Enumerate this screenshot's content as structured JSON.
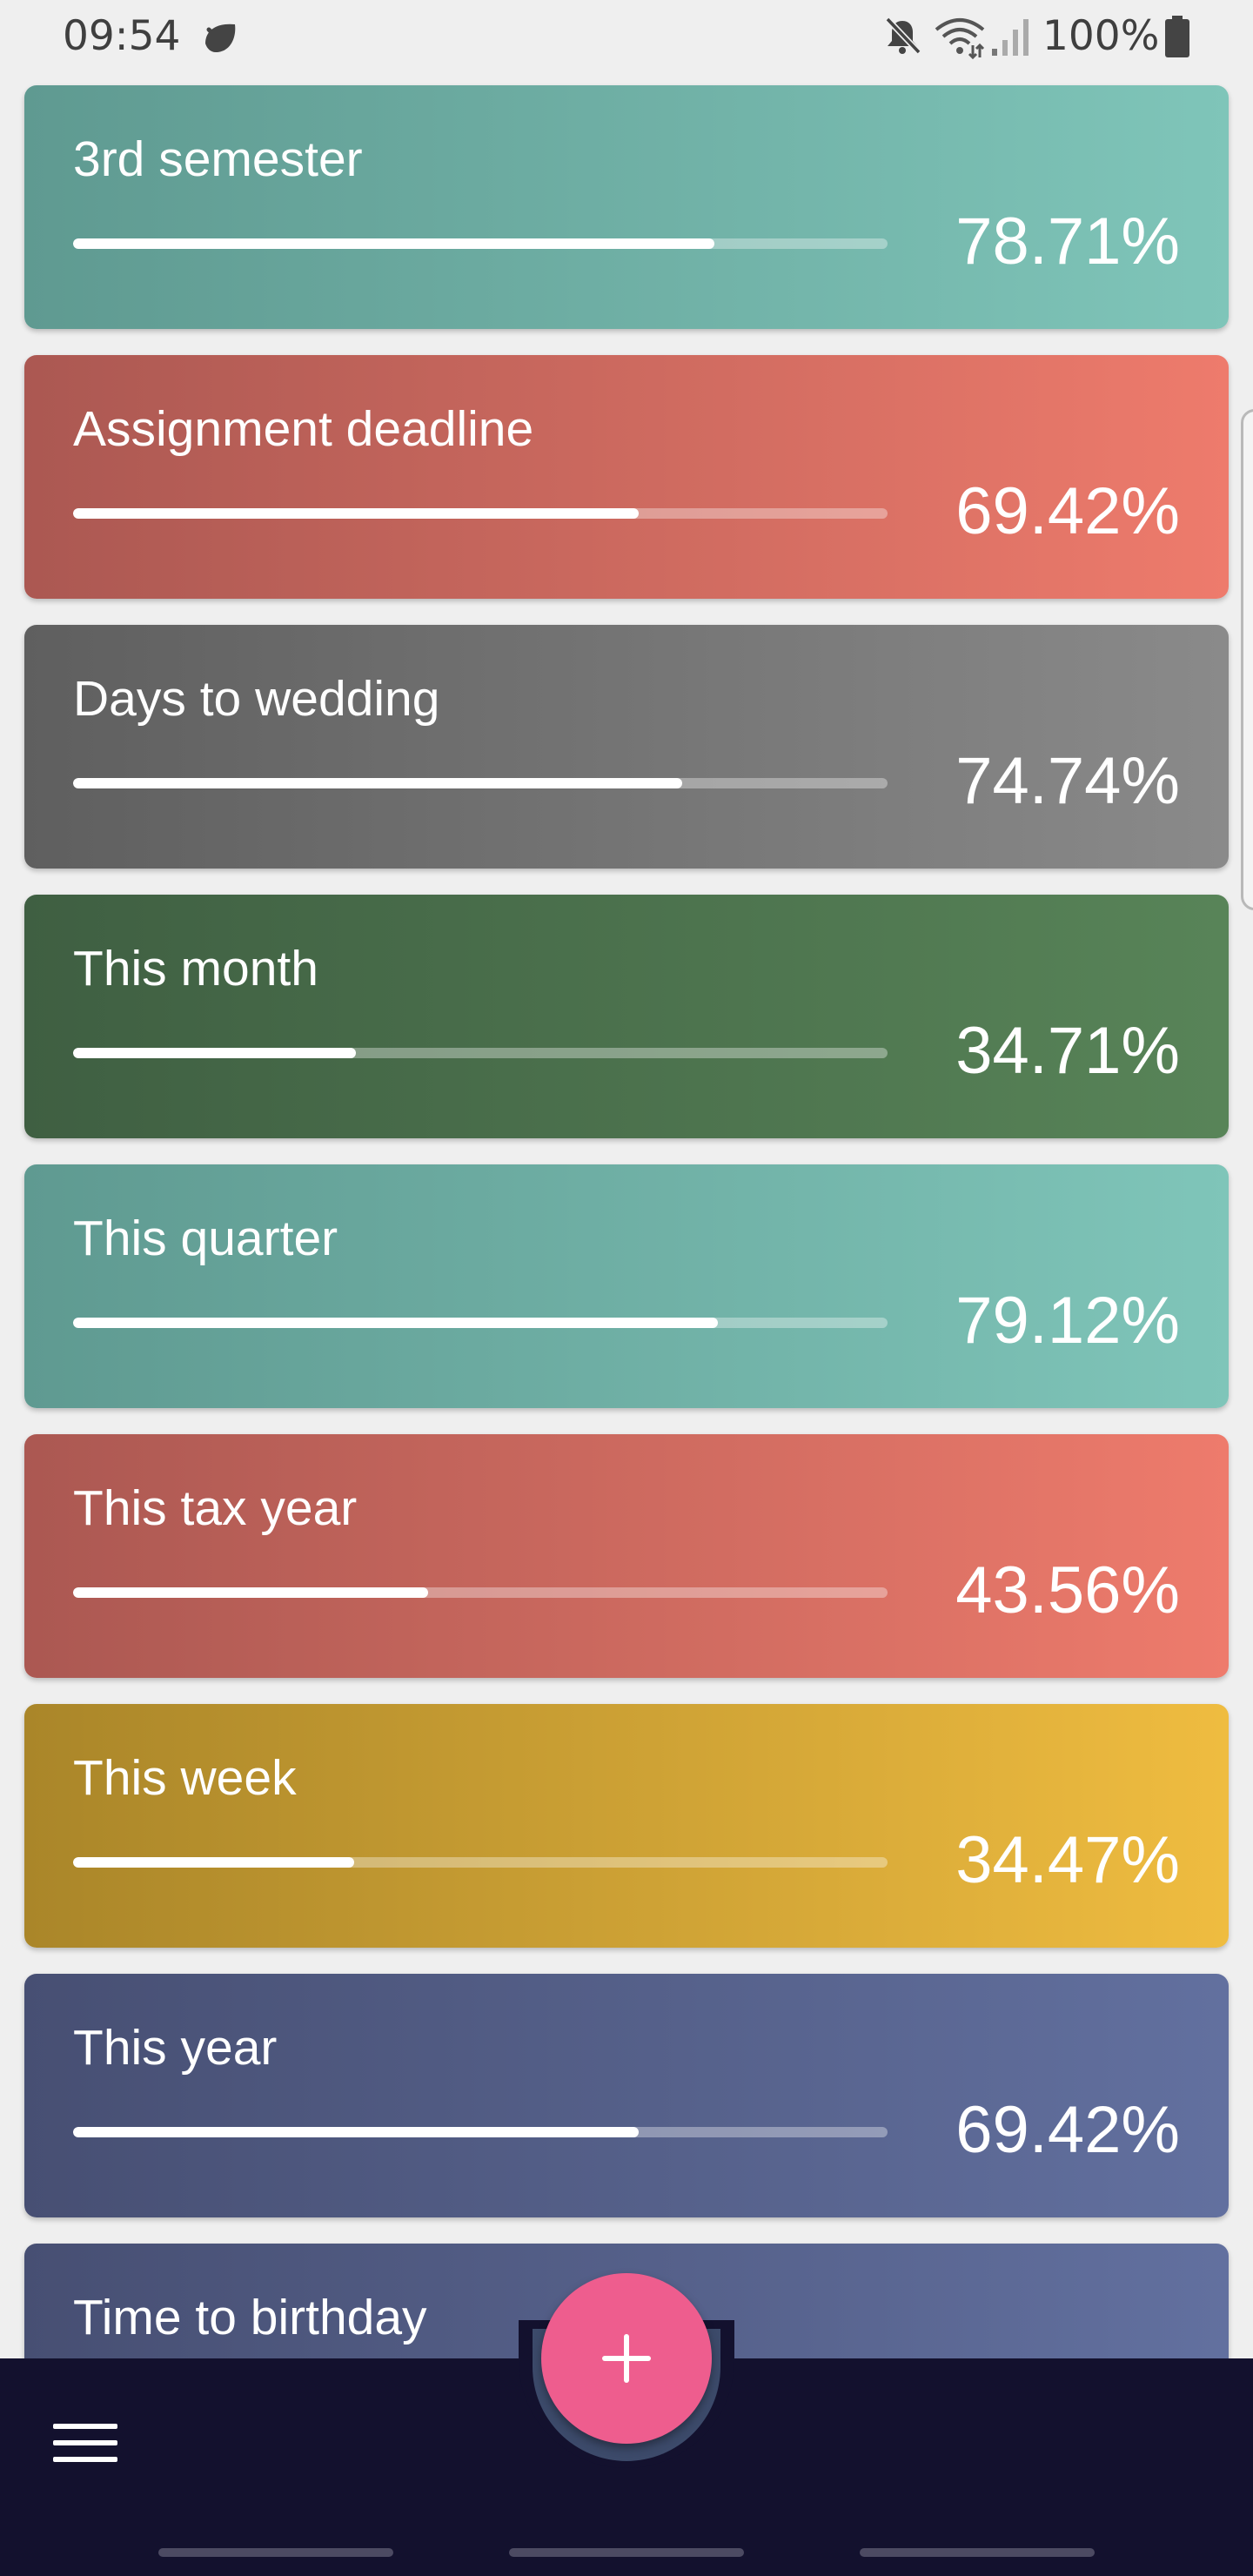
{
  "status_bar": {
    "time": "09:54",
    "battery": "100%",
    "icons": [
      "leaf-icon",
      "mute-icon",
      "wifi-icon",
      "signal-icon",
      "battery-icon"
    ]
  },
  "cards": [
    {
      "title": "3rd semester",
      "percent_text": "78.71%",
      "progress": 0.7871,
      "gradient": [
        "#5f9a91",
        "#7fc5b9"
      ]
    },
    {
      "title": "Assignment deadline",
      "percent_text": "69.42%",
      "progress": 0.6942,
      "gradient": [
        "#ab5852",
        "#ee7b6c"
      ]
    },
    {
      "title": "Days to wedding",
      "percent_text": "74.74%",
      "progress": 0.7474,
      "gradient": [
        "#5f5f5f",
        "#8a8a8a"
      ]
    },
    {
      "title": "This month",
      "percent_text": "34.71%",
      "progress": 0.3471,
      "gradient": [
        "#3f5f42",
        "#588458"
      ]
    },
    {
      "title": "This quarter",
      "percent_text": "79.12%",
      "progress": 0.7912,
      "gradient": [
        "#5f9a91",
        "#7fc5b9"
      ]
    },
    {
      "title": "This tax year",
      "percent_text": "43.56%",
      "progress": 0.4356,
      "gradient": [
        "#ab5852",
        "#ee7b6c"
      ]
    },
    {
      "title": "This week",
      "percent_text": "34.47%",
      "progress": 0.3447,
      "gradient": [
        "#aa8629",
        "#efbc40"
      ]
    },
    {
      "title": "This year",
      "percent_text": "69.42%",
      "progress": 0.6942,
      "gradient": [
        "#474f73",
        "#62709f"
      ]
    },
    {
      "title": "Time to birthday",
      "percent_text": "",
      "progress": 0,
      "gradient": [
        "#474f73",
        "#62709f"
      ]
    }
  ],
  "bottom_bar": {
    "fab_icon": "plus-icon",
    "menu_icon": "hamburger-menu-icon",
    "fab_color": "#ee5d8e",
    "bar_color": "#13112e"
  }
}
